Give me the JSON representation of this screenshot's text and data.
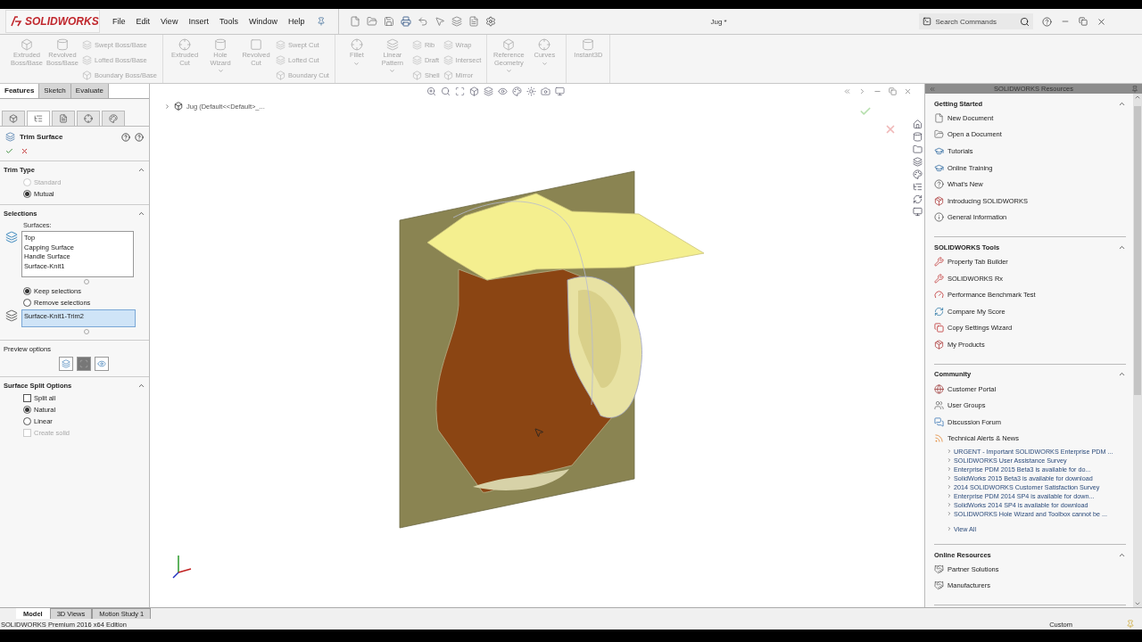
{
  "title_bar": {
    "logo": "SOLIDWORKS",
    "menu": [
      "File",
      "Edit",
      "View",
      "Insert",
      "Tools",
      "Window",
      "Help"
    ],
    "document_title": "Jug *",
    "search": {
      "placeholder": "Search Commands"
    }
  },
  "command_groups": [
    [
      {
        "kind": "large",
        "label": "Extruded Boss/Base",
        "dropdown": false
      },
      {
        "kind": "large",
        "label": "Revolved Boss/Base",
        "dropdown": false
      },
      {
        "kind": "stack",
        "items": [
          "Swept Boss/Base",
          "Lofted Boss/Base",
          "Boundary Boss/Base"
        ]
      }
    ],
    [
      {
        "kind": "large",
        "label": "Extruded Cut",
        "dropdown": false
      },
      {
        "kind": "large",
        "label": "Hole Wizard",
        "dropdown": true
      },
      {
        "kind": "large",
        "label": "Revolved Cut",
        "dropdown": false
      },
      {
        "kind": "stack",
        "items": [
          "Swept Cut",
          "Lofted Cut",
          "Boundary Cut"
        ]
      }
    ],
    [
      {
        "kind": "large",
        "label": "Fillet",
        "dropdown": true
      },
      {
        "kind": "large",
        "label": "Linear Pattern",
        "dropdown": true
      },
      {
        "kind": "stack",
        "items": [
          "Rib",
          "Draft",
          "Shell"
        ]
      },
      {
        "kind": "stack",
        "items": [
          "Wrap",
          "Intersect",
          "Mirror"
        ]
      }
    ],
    [
      {
        "kind": "large",
        "label": "Reference Geometry",
        "dropdown": true
      },
      {
        "kind": "large",
        "label": "Curves",
        "dropdown": true
      }
    ],
    [
      {
        "kind": "large",
        "label": "Instant3D",
        "dropdown": false
      }
    ]
  ],
  "feature_tabs": [
    {
      "label": "Features",
      "selected": true
    },
    {
      "label": "Sketch",
      "selected": false
    },
    {
      "label": "Evaluate",
      "selected": false
    }
  ],
  "panel_tabs": [
    {
      "selected": false
    },
    {
      "selected": true
    },
    {
      "selected": false
    },
    {
      "selected": false
    },
    {
      "selected": false
    }
  ],
  "property_manager": {
    "title": "Trim Surface",
    "sections": [
      {
        "kind": "group",
        "title": "Trim Type",
        "expanded": true,
        "controls": [
          {
            "kind": "radio",
            "label": "Standard",
            "selected": false,
            "disabled": true
          },
          {
            "kind": "radio",
            "label": "Mutual",
            "selected": true,
            "disabled": false
          }
        ]
      },
      {
        "kind": "group",
        "title": "Selections",
        "expanded": true,
        "controls": [
          {
            "kind": "caption",
            "label": "Surfaces:"
          },
          {
            "kind": "list",
            "items": [
              "Top",
              "Capping Surface",
              "Handle Surface",
              "Surface-Knit1"
            ]
          },
          {
            "kind": "radio",
            "label": "Keep selections",
            "selected": true,
            "disabled": false
          },
          {
            "kind": "radio",
            "label": "Remove selections",
            "selected": false,
            "disabled": false
          },
          {
            "kind": "field",
            "value": "Surface-Knit1-Trim2"
          }
        ]
      },
      {
        "kind": "plain",
        "title": "Preview options",
        "controls": [
          {
            "kind": "toggles",
            "buttons": [
              {
                "selected": false
              },
              {
                "selected": true
              },
              {
                "selected": false
              }
            ]
          }
        ]
      },
      {
        "kind": "group",
        "title": "Surface Split Options",
        "expanded": true,
        "controls": [
          {
            "kind": "checkbox",
            "label": "Split all",
            "checked": false,
            "disabled": false
          },
          {
            "kind": "radio",
            "label": "Natural",
            "selected": true,
            "disabled": false
          },
          {
            "kind": "radio",
            "label": "Linear",
            "selected": false,
            "disabled": false
          },
          {
            "kind": "checkbox",
            "label": "Create solid",
            "checked": false,
            "disabled": true
          }
        ]
      }
    ]
  },
  "viewport": {
    "breadcrumb": "Jug  (Default<<Default>_..."
  },
  "task_pane": {
    "title": "SOLIDWORKS Resources",
    "sections": [
      {
        "title": "Getting Started",
        "expanded": true,
        "items": [
          {
            "label": "New Document"
          },
          {
            "label": "Open a Document"
          },
          {
            "label": "Tutorials"
          },
          {
            "label": "Online Training"
          },
          {
            "label": "What's New"
          },
          {
            "label": "Introducing SOLIDWORKS"
          },
          {
            "label": "General Information"
          }
        ]
      },
      {
        "title": "SOLIDWORKS Tools",
        "expanded": true,
        "items": [
          {
            "label": "Property Tab Builder"
          },
          {
            "label": "SOLIDWORKS Rx"
          },
          {
            "label": "Performance Benchmark Test"
          },
          {
            "label": "Compare My Score"
          },
          {
            "label": "Copy Settings Wizard"
          },
          {
            "label": "My Products"
          }
        ]
      },
      {
        "title": "Community",
        "expanded": true,
        "items": [
          {
            "label": "Customer Portal"
          },
          {
            "label": "User Groups"
          },
          {
            "label": "Discussion Forum"
          },
          {
            "label": "Technical Alerts & News",
            "children": [
              "URGENT - Important SOLIDWORKS Enterprise PDM ...",
              "SOLIDWORKS User Assistance Survey",
              "Enterprise PDM 2015 Beta3 is available for do...",
              "SolidWorks 2015 Beta3 is available for download",
              "2014 SOLIDWORKS Customer Satisfaction Survey",
              "Enterprise PDM 2014 SP4 is available for down...",
              "SolidWorks 2014 SP4 is available for download",
              "SOLIDWORKS Hole Wizard and Toolbox cannot be ..."
            ],
            "more": "View All"
          }
        ]
      },
      {
        "title": "Online Resources",
        "expanded": true,
        "items": [
          {
            "label": "Partner Solutions"
          },
          {
            "label": "Manufacturers"
          }
        ]
      }
    ]
  },
  "bottom_tabs": [
    {
      "label": "Model",
      "selected": true
    },
    {
      "label": "3D Views",
      "selected": false
    },
    {
      "label": "Motion Study 1",
      "selected": false
    }
  ],
  "status_bar": {
    "text": "SOLIDWORKS Premium 2016 x64 Edition",
    "units": "Custom"
  }
}
